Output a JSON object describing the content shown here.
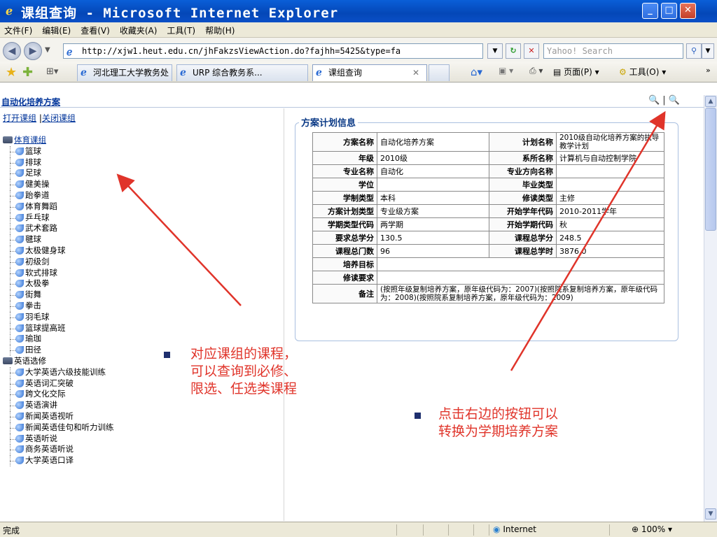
{
  "window": {
    "title": "课组查询 - Microsoft Internet Explorer"
  },
  "menu": [
    "文件(F)",
    "编辑(E)",
    "查看(V)",
    "收藏夹(A)",
    "工具(T)",
    "帮助(H)"
  ],
  "address": {
    "url": "http://xjw1.heut.edu.cn/jhFakzsViewAction.do?fajhh=5425&type=fa",
    "search_placeholder": "Yahoo! Search"
  },
  "tabs": [
    {
      "label": "河北理工大学教务处"
    },
    {
      "label": "URP 综合教务系..."
    },
    {
      "label": "课组查询"
    }
  ],
  "toolbar": {
    "page_label": "页面(P)",
    "tools_label": "工具(O)"
  },
  "page": {
    "breadcrumb": "自动化培养方案",
    "open_groups": "打开课组",
    "close_groups": "关闭课组",
    "link_sep": "|",
    "tree": [
      {
        "name": "体育课组",
        "link": true,
        "children": [
          "篮球",
          "排球",
          "足球",
          "健美操",
          "跆拳道",
          "体育舞蹈",
          "乒乓球",
          "武术套路",
          "毽球",
          "太极健身球",
          "初级剑",
          "软式排球",
          "太极拳",
          "街舞",
          "拳击",
          "羽毛球",
          "篮球提高班",
          "瑜珈",
          "田径"
        ]
      },
      {
        "name": "英语选修",
        "link": false,
        "children": [
          "大学英语六级技能训练",
          "英语词汇突破",
          "跨文化交际",
          "英语演讲",
          "新闻英语视听",
          "新闻英语佳句和听力训练",
          "英语听说",
          "商务英语听说",
          "大学英语口译"
        ]
      }
    ],
    "legend": "方案计划信息",
    "info": {
      "rows": [
        [
          {
            "l": "方案名称",
            "v": "自动化培养方案"
          },
          {
            "l": "计划名称",
            "v": "2010级自动化培养方案的执导教学计划"
          }
        ],
        [
          {
            "l": "年级",
            "v": "2010级"
          },
          {
            "l": "系所名称",
            "v": "计算机与自动控制学院"
          }
        ],
        [
          {
            "l": "专业名称",
            "v": "自动化"
          },
          {
            "l": "专业方向名称",
            "v": ""
          }
        ],
        [
          {
            "l": "学位",
            "v": ""
          },
          {
            "l": "毕业类型",
            "v": ""
          }
        ],
        [
          {
            "l": "学制类型",
            "v": "本科"
          },
          {
            "l": "修读类型",
            "v": "主修"
          }
        ],
        [
          {
            "l": "方案计划类型",
            "v": "专业级方案"
          },
          {
            "l": "开始学年代码",
            "v": "2010-2011学年"
          }
        ],
        [
          {
            "l": "学期类型代码",
            "v": "两学期"
          },
          {
            "l": "开始学期代码",
            "v": "秋"
          }
        ],
        [
          {
            "l": "要求总学分",
            "v": "130.5"
          },
          {
            "l": "课程总学分",
            "v": "248.5"
          }
        ],
        [
          {
            "l": "课程总门数",
            "v": "96"
          },
          {
            "l": "课程总学时",
            "v": "3876.0"
          }
        ]
      ],
      "wide_rows": [
        {
          "l": "培养目标",
          "v": ""
        },
        {
          "l": "修读要求",
          "v": ""
        },
        {
          "l": "备注",
          "v": "(按照年级复制培养方案，原年级代码为：2007)(按照院系复制培养方案，原年级代码为：2008)(按照院系复制培养方案，原年级代码为：2009)"
        }
      ]
    }
  },
  "annotations": {
    "left": [
      "对应课组的课程，",
      "可以查询到必修、",
      "限选、任选类课程"
    ],
    "right": [
      "点击右边的按钮可以",
      "转换为学期培养方案"
    ],
    "color": "#e0342a"
  },
  "status": {
    "text": "完成",
    "zone": "Internet",
    "zoom": "100%"
  }
}
